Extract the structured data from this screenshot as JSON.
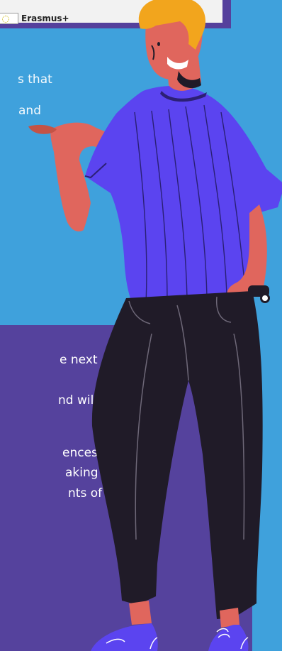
{
  "banner": {
    "program_label": "Erasmus+"
  },
  "colors": {
    "background": "#3fa1dc",
    "panel": "#55429d",
    "shirt": "#5b44f0",
    "pants": "#201b28",
    "skin": "#e0665d",
    "hair": "#f2a51d"
  },
  "upper_text": {
    "line1": "s that",
    "line2": "and"
  },
  "lower_text": {
    "line1": "e next",
    "line2": "nd will",
    "line3": "ences,",
    "line4": "aking",
    "line5": "nts of"
  },
  "illustration": {
    "icon": "standing-man-illustration"
  }
}
